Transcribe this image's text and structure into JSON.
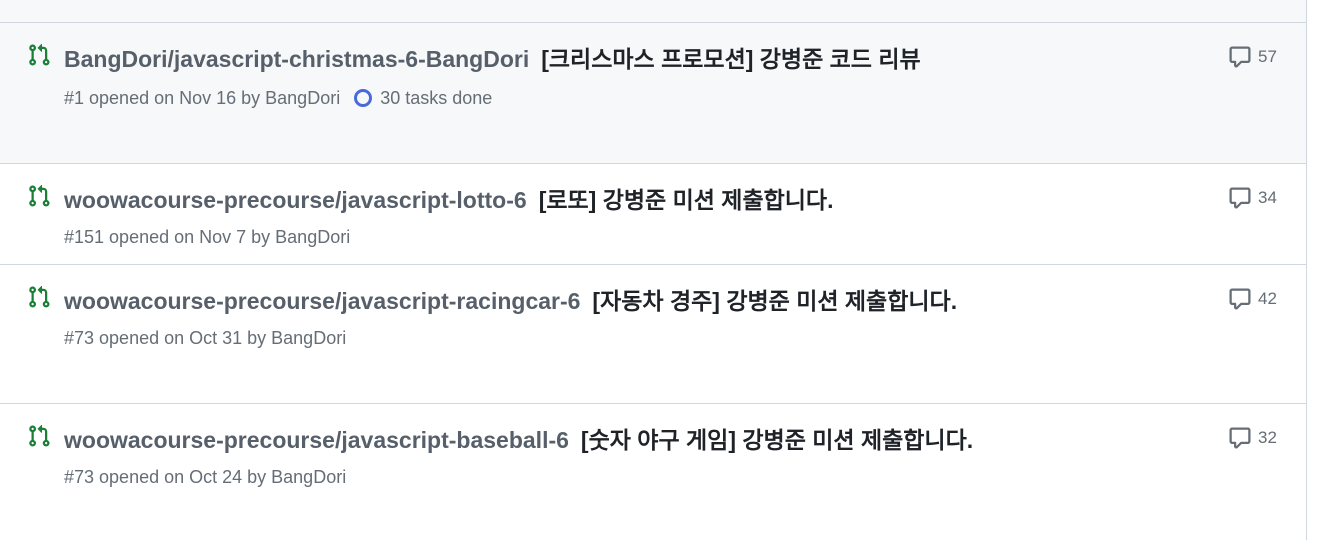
{
  "colors": {
    "pr_icon": "#1a7f37",
    "muted": "#656d76",
    "task_ring": "#4a6ad8"
  },
  "pull_requests": [
    {
      "repo": "BangDori/javascript-christmas-6-BangDori",
      "title": "[크리스마스 프로모션] 강병준 코드 리뷰",
      "meta": "#1 opened on Nov 16 by BangDori",
      "tasks": "30 tasks done",
      "comments": "57",
      "icon": "git-pull-request-icon"
    },
    {
      "repo": "woowacourse-precourse/javascript-lotto-6",
      "title": "[로또] 강병준 미션 제출합니다.",
      "meta": "#151 opened on Nov 7 by BangDori",
      "comments": "34",
      "icon": "git-pull-request-icon"
    },
    {
      "repo": "woowacourse-precourse/javascript-racingcar-6",
      "title": "[자동차 경주] 강병준 미션 제출합니다.",
      "meta": "#73 opened on Oct 31 by BangDori",
      "comments": "42",
      "icon": "git-pull-request-icon"
    },
    {
      "repo": "woowacourse-precourse/javascript-baseball-6",
      "title": "[숫자 야구 게임] 강병준 미션 제출합니다.",
      "meta": "#73 opened on Oct 24 by BangDori",
      "comments": "32",
      "icon": "git-pull-request-icon"
    }
  ]
}
